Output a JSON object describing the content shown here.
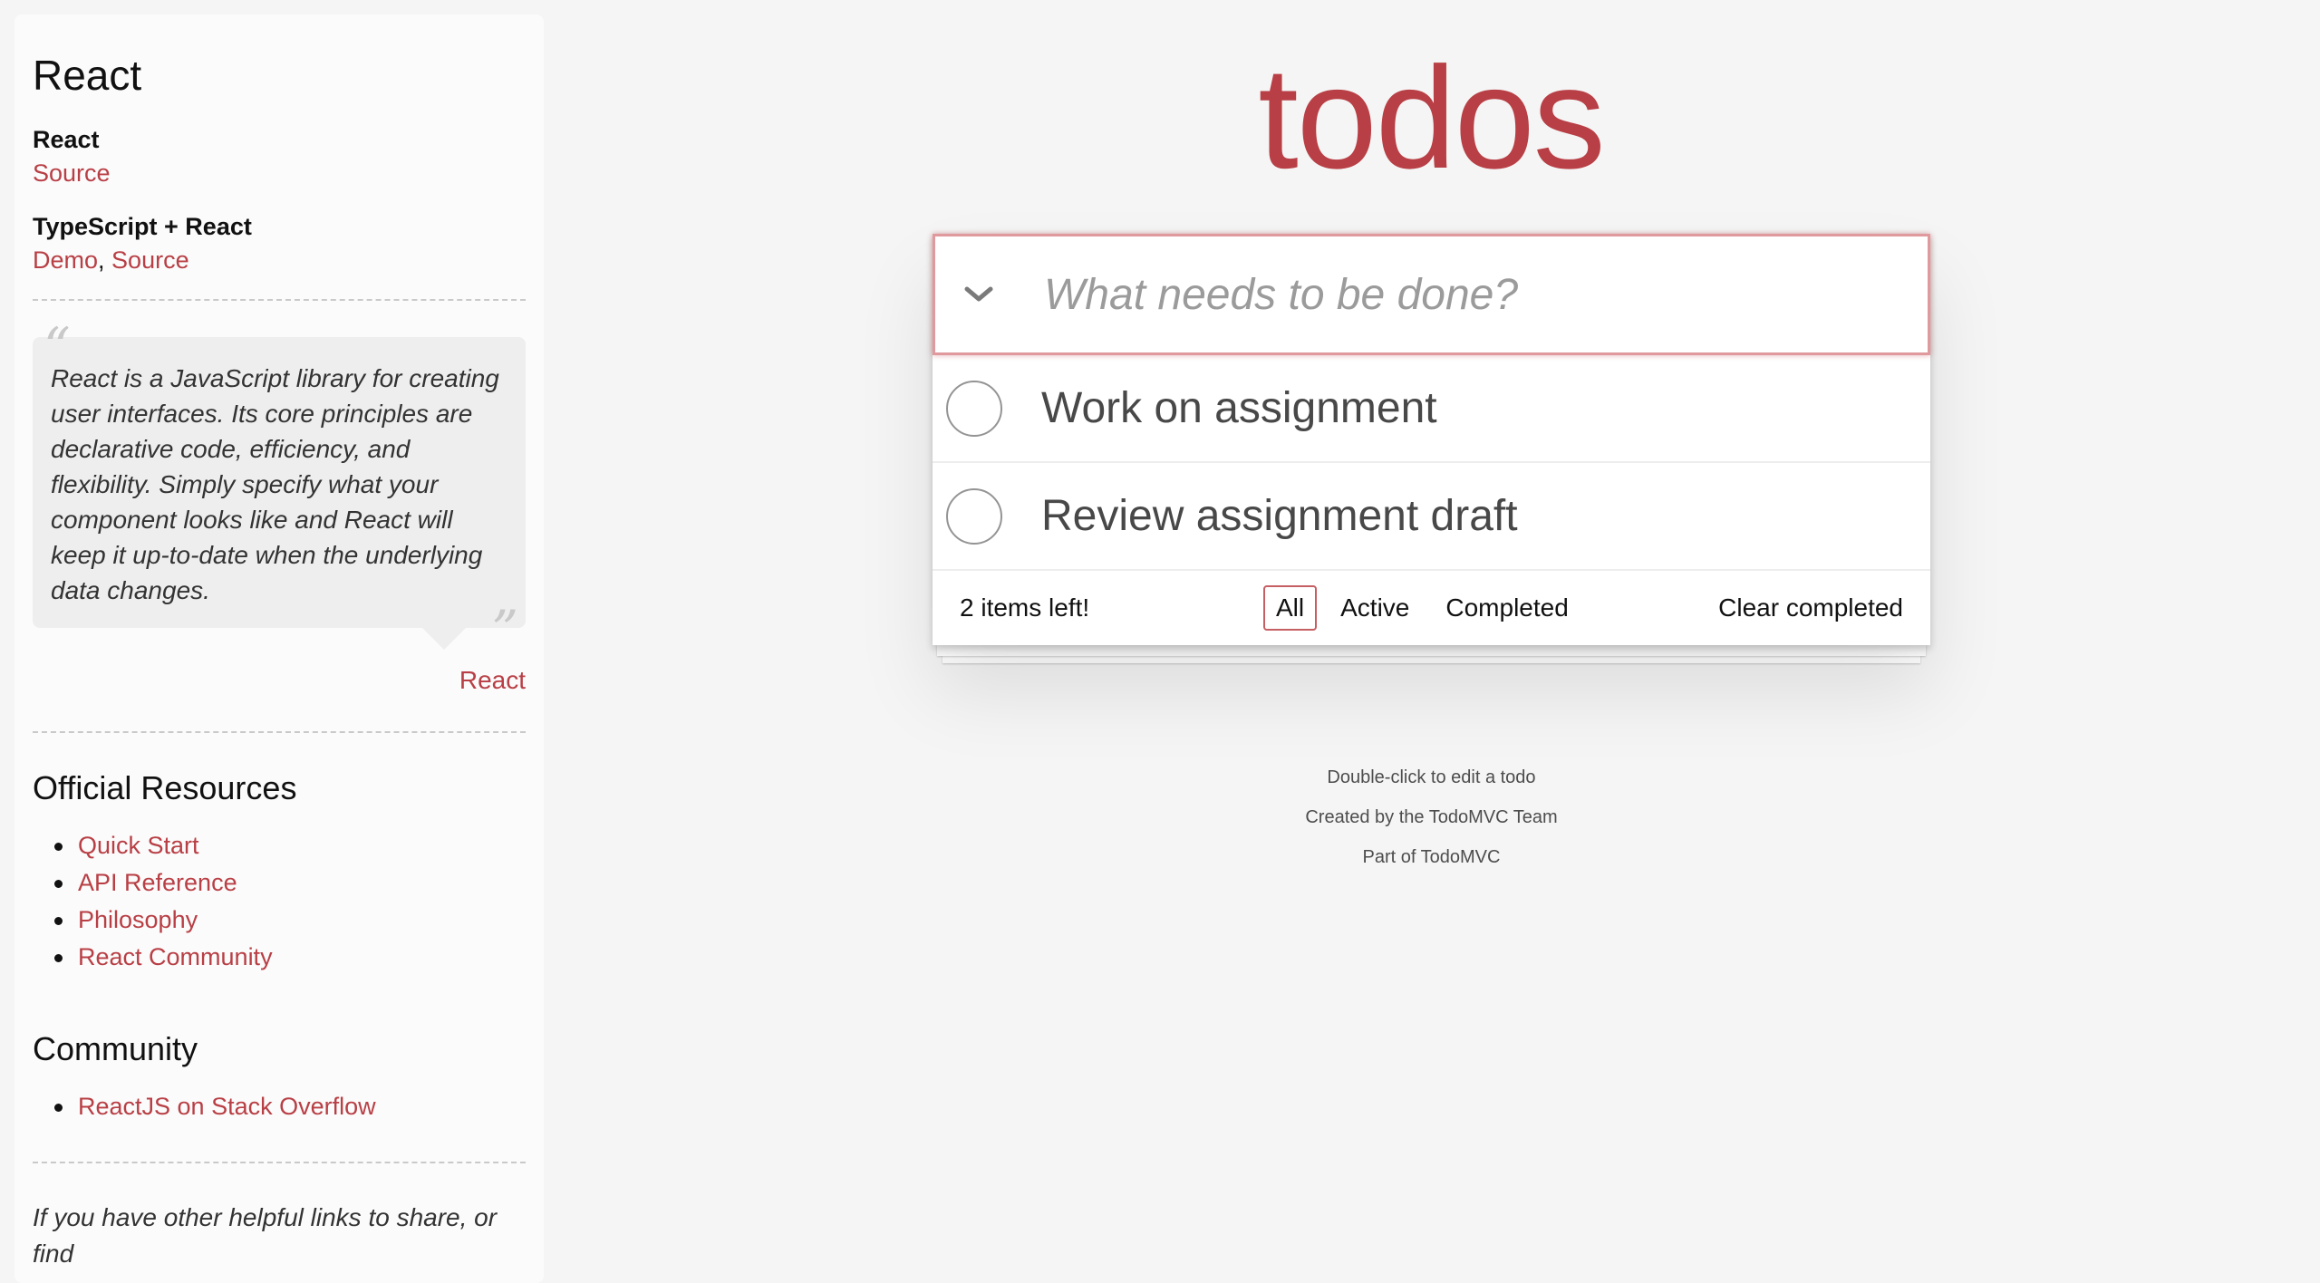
{
  "sidebar": {
    "title": "React",
    "implementations": [
      {
        "name": "React",
        "links": [
          "Source"
        ]
      },
      {
        "name": "TypeScript + React",
        "links": [
          "Demo",
          "Source"
        ]
      }
    ],
    "quote": {
      "text": "React is a JavaScript library for creating user interfaces. Its core principles are declarative code, efficiency, and flexibility. Simply specify what your component looks like and React will keep it up-to-date when the underlying data changes.",
      "attribution": "React"
    },
    "official_resources": {
      "heading": "Official Resources",
      "items": [
        "Quick Start",
        "API Reference",
        "Philosophy",
        "React Community"
      ]
    },
    "community": {
      "heading": "Community",
      "items": [
        "ReactJS on Stack Overflow"
      ]
    },
    "footer_text": "If you have other helpful links to share, or find"
  },
  "app": {
    "title": "todos",
    "new_todo_placeholder": "What needs to be done?",
    "todos": [
      {
        "label": "Work on assignment",
        "completed": false
      },
      {
        "label": "Review assignment draft",
        "completed": false
      }
    ],
    "footer": {
      "count_text": "2 items left!",
      "filters": [
        "All",
        "Active",
        "Completed"
      ],
      "selected_filter": "All",
      "clear_label": "Clear completed"
    }
  },
  "info": {
    "line1": "Double-click to edit a todo",
    "line2": "Created by the TodoMVC Team",
    "line3_prefix": "Part of ",
    "line3_link": "TodoMVC"
  },
  "colors": {
    "accent": "#b83f45",
    "background": "#f5f5f5"
  }
}
